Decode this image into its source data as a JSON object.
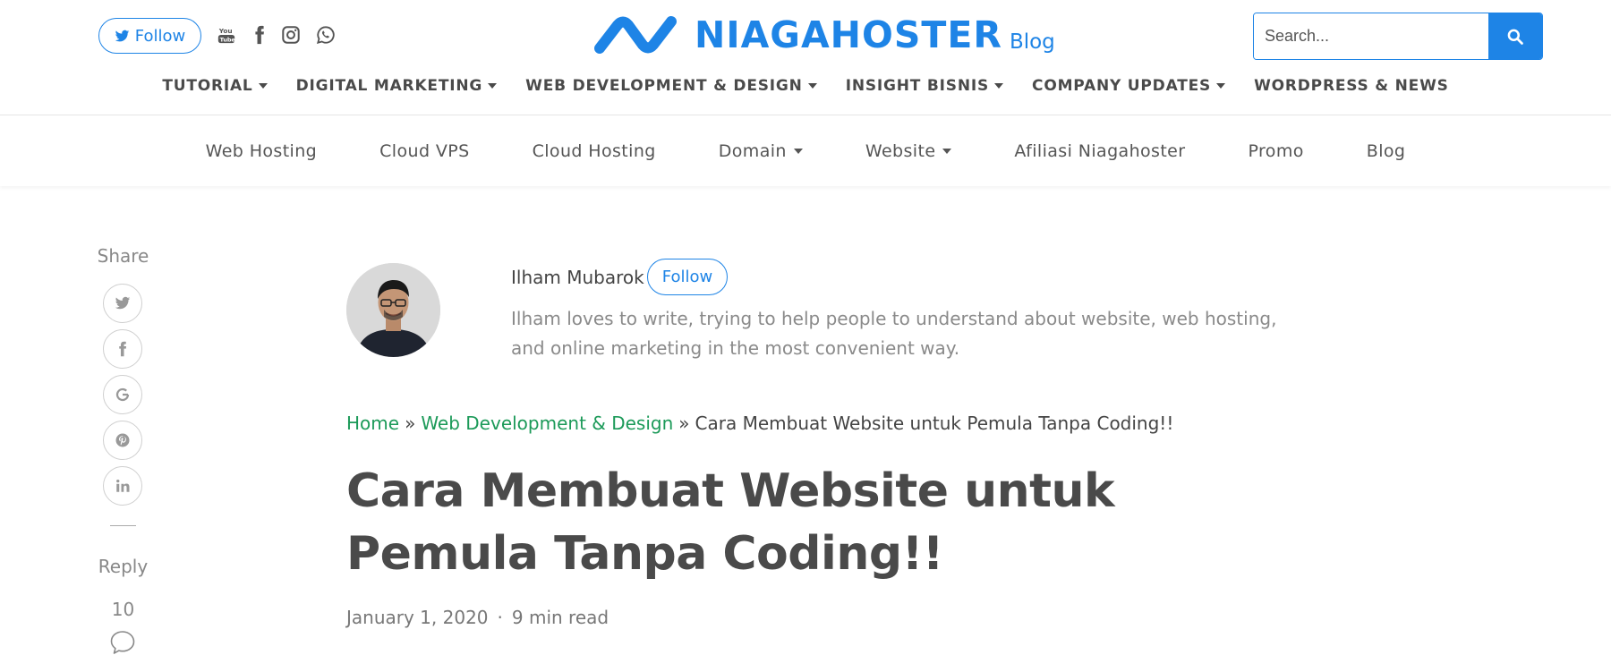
{
  "header": {
    "follow_label": "Follow",
    "social_icons": [
      "youtube-icon",
      "facebook-icon",
      "instagram-icon",
      "whatsapp-icon"
    ],
    "logo_text": "NIAGAHOSTER",
    "logo_suffix": "Blog",
    "search_placeholder": "Search...",
    "brand_color": "#1e84e6"
  },
  "category_nav": [
    {
      "label": "TUTORIAL",
      "dropdown": true
    },
    {
      "label": "DIGITAL MARKETING",
      "dropdown": true
    },
    {
      "label": "WEB DEVELOPMENT & DESIGN",
      "dropdown": true
    },
    {
      "label": "INSIGHT BISNIS",
      "dropdown": true
    },
    {
      "label": "COMPANY UPDATES",
      "dropdown": true
    },
    {
      "label": "WORDPRESS & NEWS",
      "dropdown": false
    }
  ],
  "product_nav": [
    {
      "label": "Web Hosting",
      "dropdown": false
    },
    {
      "label": "Cloud VPS",
      "dropdown": false
    },
    {
      "label": "Cloud Hosting",
      "dropdown": false
    },
    {
      "label": "Domain",
      "dropdown": true
    },
    {
      "label": "Website",
      "dropdown": true
    },
    {
      "label": "Afiliasi Niagahoster",
      "dropdown": false
    },
    {
      "label": "Promo",
      "dropdown": false
    },
    {
      "label": "Blog",
      "dropdown": false
    }
  ],
  "share": {
    "label": "Share",
    "buttons": [
      "twitter-icon",
      "facebook-icon",
      "google-icon",
      "pinterest-icon",
      "linkedin-icon"
    ],
    "reply_label": "Reply",
    "reply_count": "10"
  },
  "author": {
    "name": "Ilham Mubarok",
    "follow_label": "Follow",
    "bio": "Ilham loves to write, trying to help people to understand about website, web hosting, and online marketing in the most convenient way."
  },
  "breadcrumb": {
    "home": "Home",
    "separator": "»",
    "category": "Web Development & Design",
    "current": "Cara Membuat Website untuk Pemula Tanpa Coding!!",
    "link_color": "#1c9a59"
  },
  "post": {
    "title": "Cara Membuat Website untuk Pemula Tanpa Coding!!",
    "date": "January 1, 2020",
    "dot": "·",
    "read_time": "9 min read"
  }
}
